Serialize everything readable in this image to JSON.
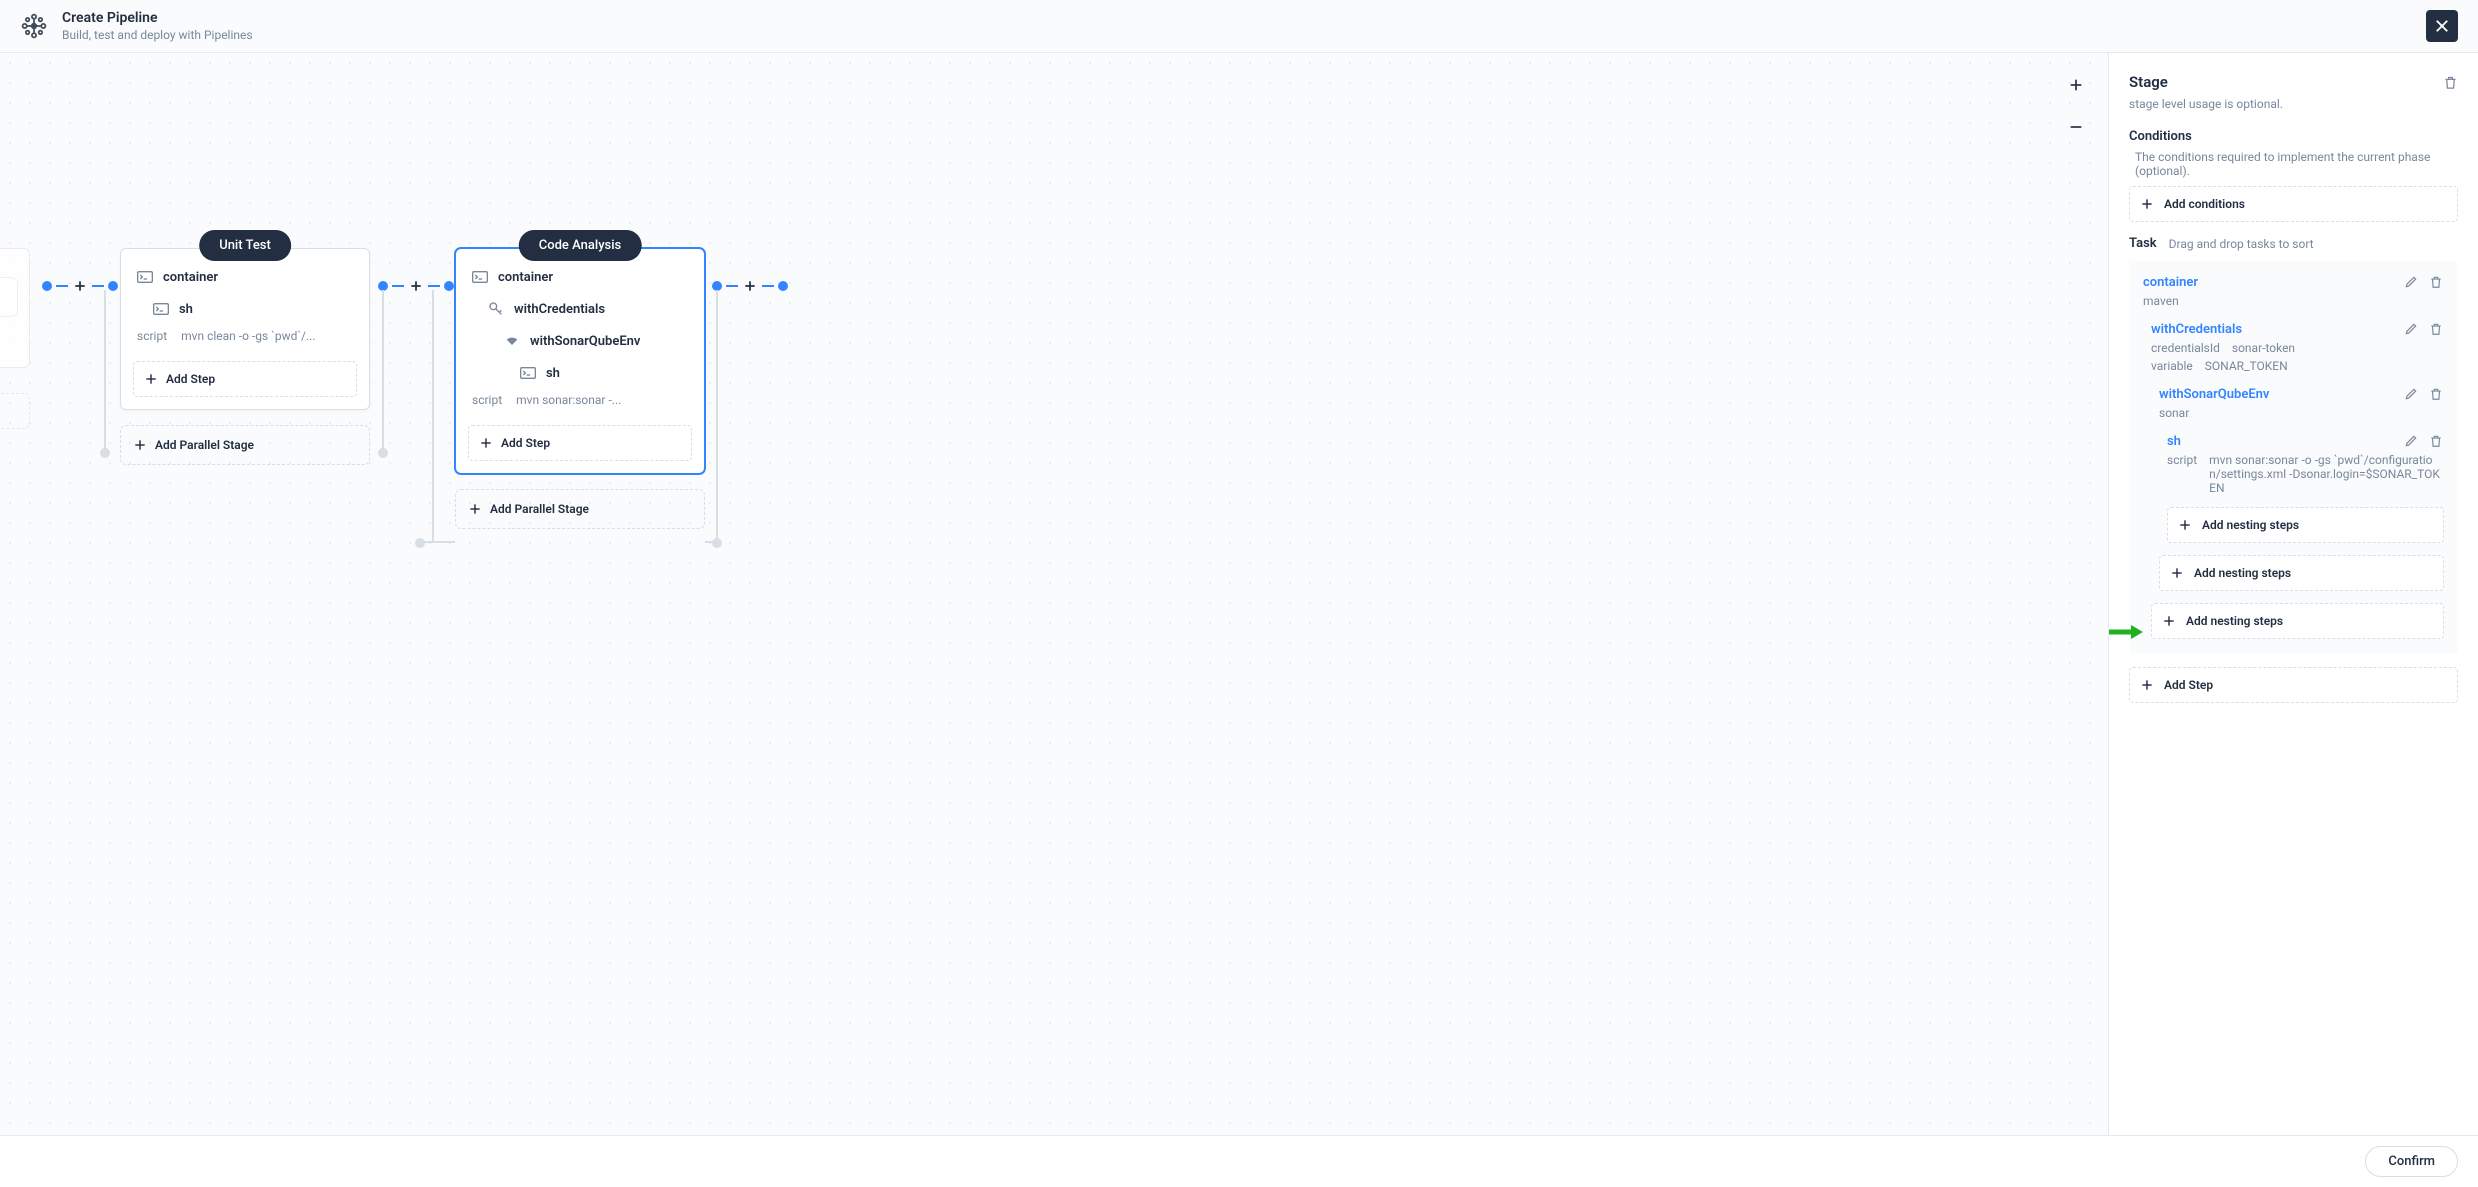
{
  "header": {
    "title": "Create Pipeline",
    "subtitle": "Build, test and deploy with Pipelines"
  },
  "stages": {
    "unitTest": {
      "name": "Unit Test",
      "container": "container",
      "sh": "sh",
      "scriptLabel": "script",
      "scriptVal": "mvn clean -o -gs `pwd`/...",
      "addStep": "Add Step",
      "addParallel": "Add Parallel Stage"
    },
    "codeAnalysis": {
      "name": "Code Analysis",
      "container": "container",
      "withCredentials": "withCredentials",
      "withSonar": "withSonarQubeEnv",
      "sh": "sh",
      "scriptLabel": "script",
      "scriptVal": "mvn sonar:sonar -...",
      "addStep": "Add Step",
      "addParallel": "Add Parallel Stage"
    }
  },
  "panel": {
    "stageHeading": "Stage",
    "stageDesc": "stage level usage is optional.",
    "conditionsHeading": "Conditions",
    "conditionsDesc": "The conditions required to implement the current phase (optional).",
    "addConditions": "Add conditions",
    "taskHeading": "Task",
    "taskDesc": "Drag and drop tasks to sort",
    "container": {
      "title": "container",
      "value": "maven"
    },
    "withCredentials": {
      "title": "withCredentials",
      "credLabel": "credentialsId",
      "credValue": "sonar-token",
      "varLabel": "variable",
      "varValue": "SONAR_TOKEN"
    },
    "withSonar": {
      "title": "withSonarQubeEnv",
      "value": "sonar"
    },
    "sh": {
      "title": "sh",
      "scriptLabel": "script",
      "scriptValue": "mvn sonar:sonar -o -gs `pwd`/configuration/settings.xml -Dsonar.login=$SONAR_TOKEN"
    },
    "addNesting": "Add nesting steps",
    "addStep": "Add Step"
  },
  "footer": {
    "confirm": "Confirm"
  }
}
